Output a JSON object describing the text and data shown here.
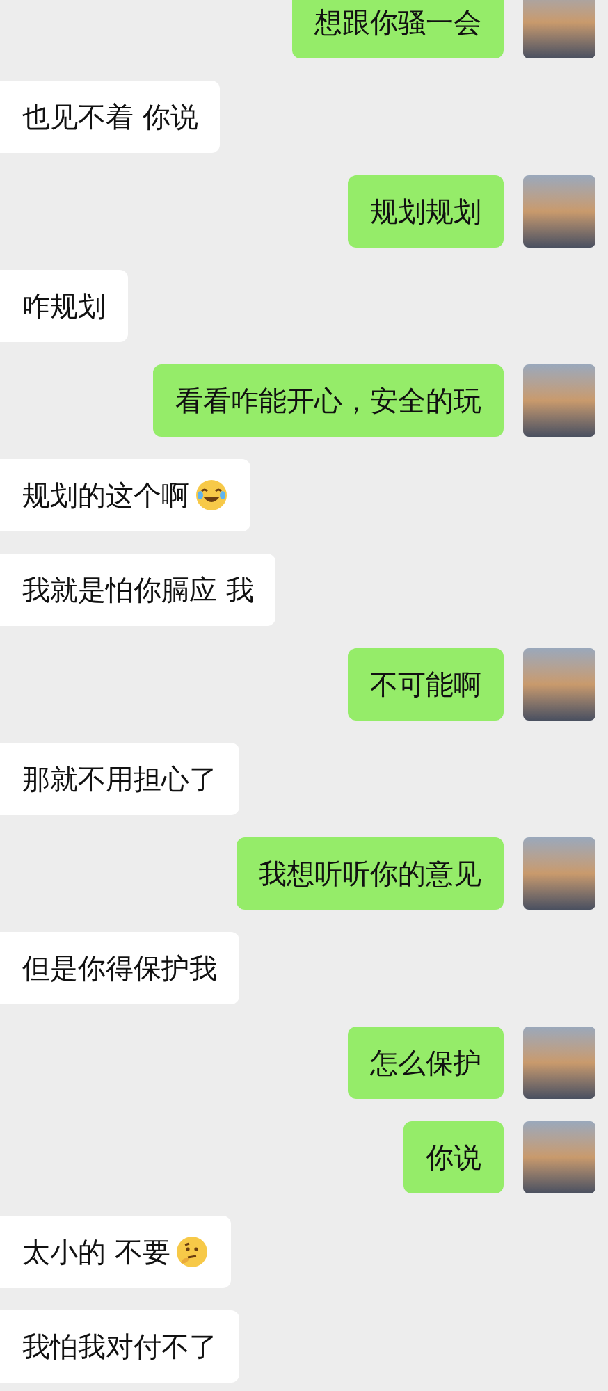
{
  "messages": [
    {
      "kind": "outgoing",
      "text": "想跟你骚一会"
    },
    {
      "kind": "incoming",
      "text": "也见不着 你说"
    },
    {
      "kind": "outgoing",
      "text": "规划规划"
    },
    {
      "kind": "incoming",
      "text": "咋规划"
    },
    {
      "kind": "outgoing",
      "text": "看看咋能开心，安全的玩"
    },
    {
      "kind": "incoming",
      "text": "规划的这个啊",
      "emoji": {
        "kind": "laugh"
      }
    },
    {
      "kind": "incoming",
      "text": "我就是怕你膈应 我"
    },
    {
      "kind": "outgoing",
      "text": "不可能啊"
    },
    {
      "kind": "incoming",
      "text": "那就不用担心了"
    },
    {
      "kind": "outgoing",
      "text": "我想听听你的意见"
    },
    {
      "kind": "incoming",
      "text": "但是你得保护我"
    },
    {
      "kind": "outgoing",
      "text": "怎么保护"
    },
    {
      "kind": "outgoing",
      "text": "你说"
    },
    {
      "kind": "incoming",
      "text": "太小的 不要",
      "emoji": {
        "kind": "think"
      }
    },
    {
      "kind": "incoming",
      "text": "我怕我对付不了"
    }
  ]
}
